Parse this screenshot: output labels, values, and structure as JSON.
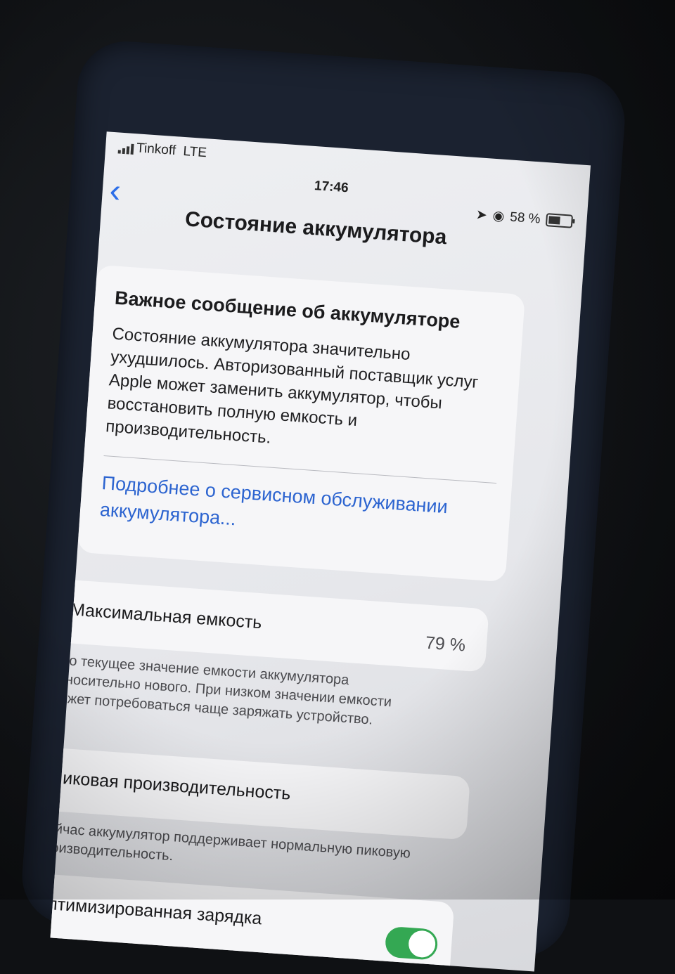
{
  "status_bar": {
    "carrier": "Tinkoff",
    "network": "LTE",
    "time": "17:46",
    "battery_percent": "58 %"
  },
  "nav": {
    "back_icon": "chevron-left-icon",
    "title": "Состояние аккумулятора"
  },
  "important_message": {
    "title": "Важное сообщение об аккумуляторе",
    "body": "Состояние аккумулятора значительно ухудшилось. Авторизованный поставщик услуг Apple может заменить аккумулятор, чтобы восстановить полную емкость и производительность.",
    "link": "Подробнее о сервисном обслуживании аккумулятора..."
  },
  "max_capacity": {
    "label": "Максимальная емкость",
    "value": "79 %",
    "note": "Это текущее значение емкости аккумулятора относительно нового. При низком значении емкости может потребоваться чаще заряжать устройство."
  },
  "peak_performance": {
    "label": "Пиковая производительность",
    "note": "Сейчас аккумулятор поддерживает нормальную пиковую производительность."
  },
  "optimized_charging": {
    "label": "Оптимизированная зарядка",
    "enabled": true
  },
  "colors": {
    "accent": "#2c64d0",
    "toggle_on": "#34a853"
  }
}
